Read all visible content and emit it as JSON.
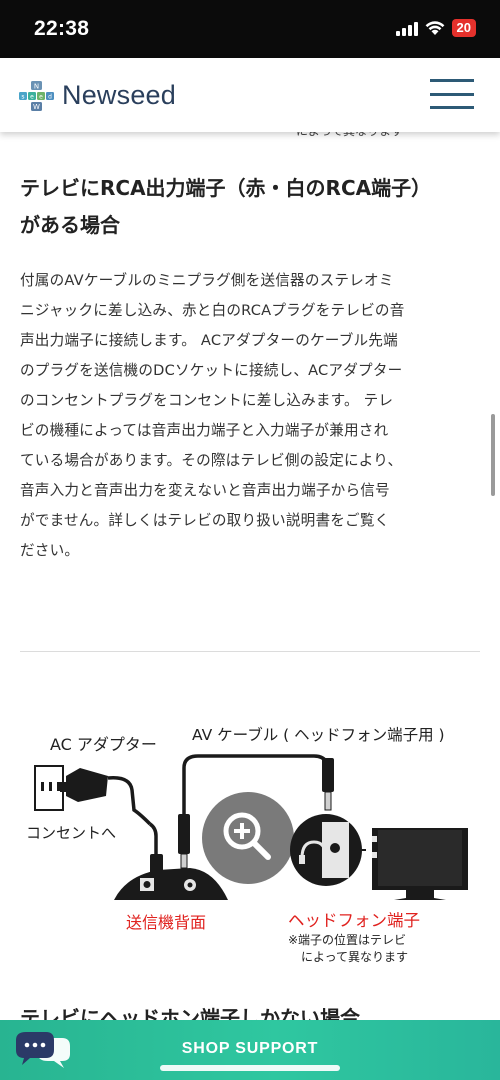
{
  "status_bar": {
    "time": "22:38",
    "battery": "20",
    "icons": [
      "signal-icon",
      "wifi-icon",
      "battery-icon"
    ]
  },
  "header": {
    "logo_text": "Newseed",
    "logo_mark_letters": [
      "N",
      "s",
      "e",
      "e",
      "d",
      "W"
    ],
    "menu_icon": "hamburger-menu-icon"
  },
  "peek_text": "によって異なります",
  "article": {
    "heading_line1": "テレビにRCA出力端子（赤・白のRCA端子）",
    "heading_line2": "がある場合",
    "paragraph_lines": [
      "付属のAVケーブルのミニプラグ側を送信器のステレオミ",
      "ニジャックに差し込み、赤と白のRCAプラグをテレビの音",
      "声出力端子に接続します。 ACアダプターのケーブル先端",
      "のプラグを送信機のDCソケットに接続し、ACアダプター",
      "のコンセントプラグをコンセントに差し込みます。 テレ",
      "ビの機種によっては音声出力端子と入力端子が兼用され",
      "ている場合があります。その際はテレビ側の設定により、",
      "音声入力と音声出力を変えないと音声出力端子から信号",
      "がでません。詳しくはテレビの取り扱い説明書をご覧く",
      "ださい。"
    ],
    "next_heading": "テレビにヘッドホン端子しかない場合"
  },
  "diagram": {
    "ac_adapter": "AC アダプター",
    "av_cable": "AV ケーブル ( ヘッドフォン端子用 )",
    "outlet": "コンセントへ",
    "transmitter_back": "送信機背面",
    "headphone_jack": "ヘッドフォン端子",
    "note_line1": "※端子の位置はテレビ",
    "note_line2": "によって異なります",
    "zoom_icon": "zoom-in-icon",
    "colors": {
      "red_label": "#e0221f",
      "dark": "#1a1a1a",
      "grey_circle": "#6b6b6b"
    }
  },
  "footer": {
    "shop_support": "SHOP SUPPORT",
    "chat_icon": "chat-bubble-icon",
    "gradient_from": "#28b491",
    "gradient_to": "#2fc7a0"
  }
}
